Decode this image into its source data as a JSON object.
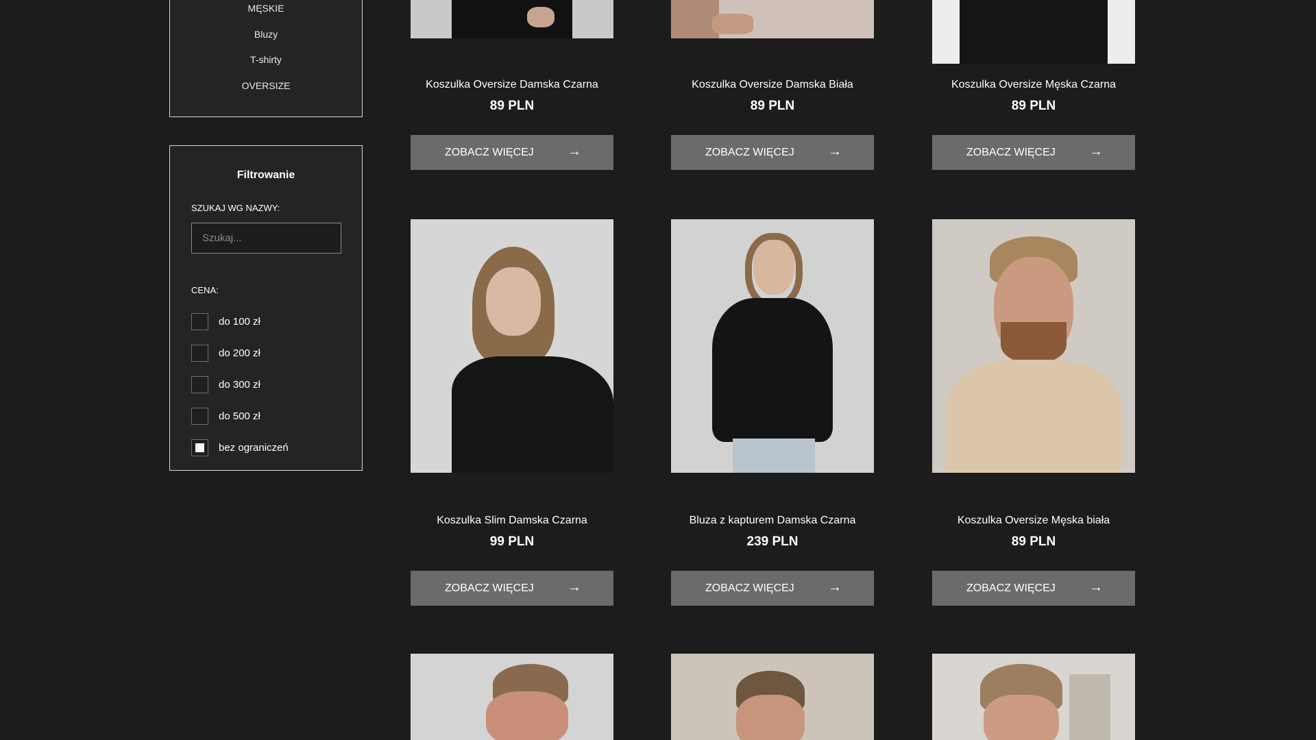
{
  "sidebar": {
    "categories": [
      "MĘSKIE",
      "Bluzy",
      "T-shirty",
      "OVERSIZE"
    ],
    "filter": {
      "title": "Filtrowanie",
      "search_label": "SZUKAJ WG NAZWY:",
      "search_placeholder": "Szukaj...",
      "search_value": "",
      "price_label": "CENA:",
      "price_options": [
        {
          "label": "do 100 zł",
          "checked": false
        },
        {
          "label": "do 200 zł",
          "checked": false
        },
        {
          "label": "do 300 zł",
          "checked": false
        },
        {
          "label": "do 500 zł",
          "checked": false
        },
        {
          "label": "bez ograniczeń",
          "checked": true
        }
      ]
    }
  },
  "products": [
    {
      "name": "Koszulka Oversize Damska Czarna",
      "price": "89 PLN",
      "button": "ZOBACZ WIĘCEJ",
      "arrow": "→"
    },
    {
      "name": "Koszulka Oversize Damska Biała",
      "price": "89 PLN",
      "button": "ZOBACZ WIĘCEJ",
      "arrow": "→"
    },
    {
      "name": "Koszulka Oversize Męska Czarna",
      "price": "89 PLN",
      "button": "ZOBACZ WIĘCEJ",
      "arrow": "→"
    },
    {
      "name": "Koszulka Slim Damska Czarna",
      "price": "99 PLN",
      "button": "ZOBACZ WIĘCEJ",
      "arrow": "→"
    },
    {
      "name": "Bluza z kapturem Damska Czarna",
      "price": "239 PLN",
      "button": "ZOBACZ WIĘCEJ",
      "arrow": "→"
    },
    {
      "name": "Koszulka Oversize Męska biała",
      "price": "89 PLN",
      "button": "ZOBACZ WIĘCEJ",
      "arrow": "→"
    }
  ],
  "colors": {
    "page_background": "#1c1c1c",
    "panel_background": "#242424",
    "button_background": "#6b6b6b",
    "text": "#ffffff"
  }
}
